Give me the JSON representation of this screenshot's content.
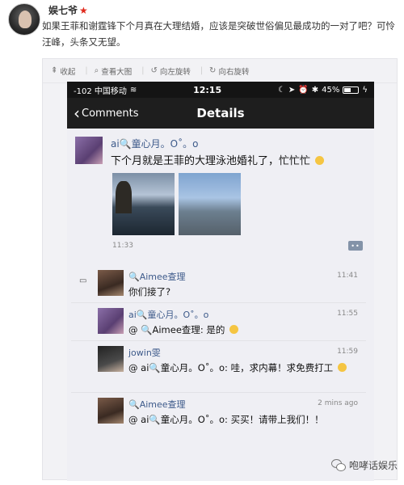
{
  "post": {
    "author": "娱七爷",
    "text": "如果王菲和谢霆锋下个月真在大理结婚，应该是突破世俗偏见最成功的一对了吧？可怜汪峰，头条又无望。"
  },
  "toolbar": {
    "collapse": "收起",
    "view_large": "查看大图",
    "rotate_left": "向左旋转",
    "rotate_right": "向右旋转"
  },
  "phone": {
    "status": {
      "carrier": "-102 中国移动",
      "time": "12:15",
      "battery": "45%"
    },
    "nav": {
      "back_label": "Comments",
      "title": "Details"
    },
    "moment": {
      "name": "ai🔍童心月。O˚。o",
      "text": "下个月就是王菲的大理泳池婚礼了，忙忙忙",
      "time": "11:33",
      "more": "••"
    },
    "comments": [
      {
        "name": "🔍Aimee查理",
        "time": "11:41",
        "text": "你们接了?"
      },
      {
        "name": "ai🔍童心月。O˚。o",
        "time": "11:55",
        "text": "@ 🔍Aimee查理: 是的"
      },
      {
        "name": "jowin雯",
        "time": "11:59",
        "text": "@ ai🔍童心月。O˚。o: 哇，求内幕！求免费打工"
      },
      {
        "name": "🔍Aimee查理",
        "time": "2 mins ago",
        "text": "@ ai🔍童心月。O˚。o: 买买！请带上我们！！"
      }
    ]
  },
  "watermark": "咆哮话娱乐",
  "colors": {
    "link_blue": "#3d5a8a",
    "star_red": "#e0291c",
    "nav_dark": "#1e1e1e"
  }
}
